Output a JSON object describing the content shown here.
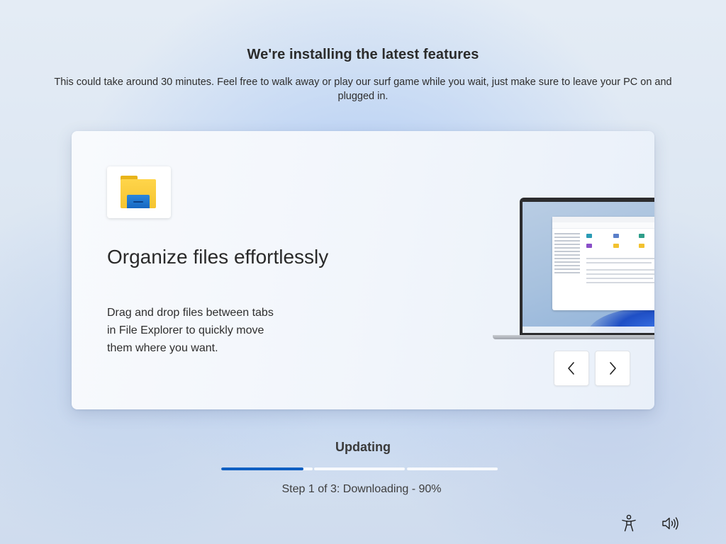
{
  "header": {
    "title": "We're installing the latest features",
    "subtitle": "This could take around 30 minutes. Feel free to walk away or play our surf game while you wait, just make sure to leave your PC on and plugged in."
  },
  "card": {
    "app_icon": "file-explorer-folder-icon",
    "feature_title": "Organize files effortlessly",
    "feature_description": "Drag and drop files between tabs in File Explorer to quickly move them where you want.",
    "previous_icon": "chevron-left-icon",
    "next_icon": "chevron-right-icon"
  },
  "status": {
    "label": "Updating",
    "step_text": "Step 1 of 3: Downloading - 90%",
    "steps": [
      {
        "progress": 0.9
      },
      {
        "progress": 0
      },
      {
        "progress": 0
      }
    ],
    "accent_color": "#0f5fc2"
  },
  "footer": {
    "accessibility_icon": "accessibility-icon",
    "volume_icon": "volume-icon"
  }
}
